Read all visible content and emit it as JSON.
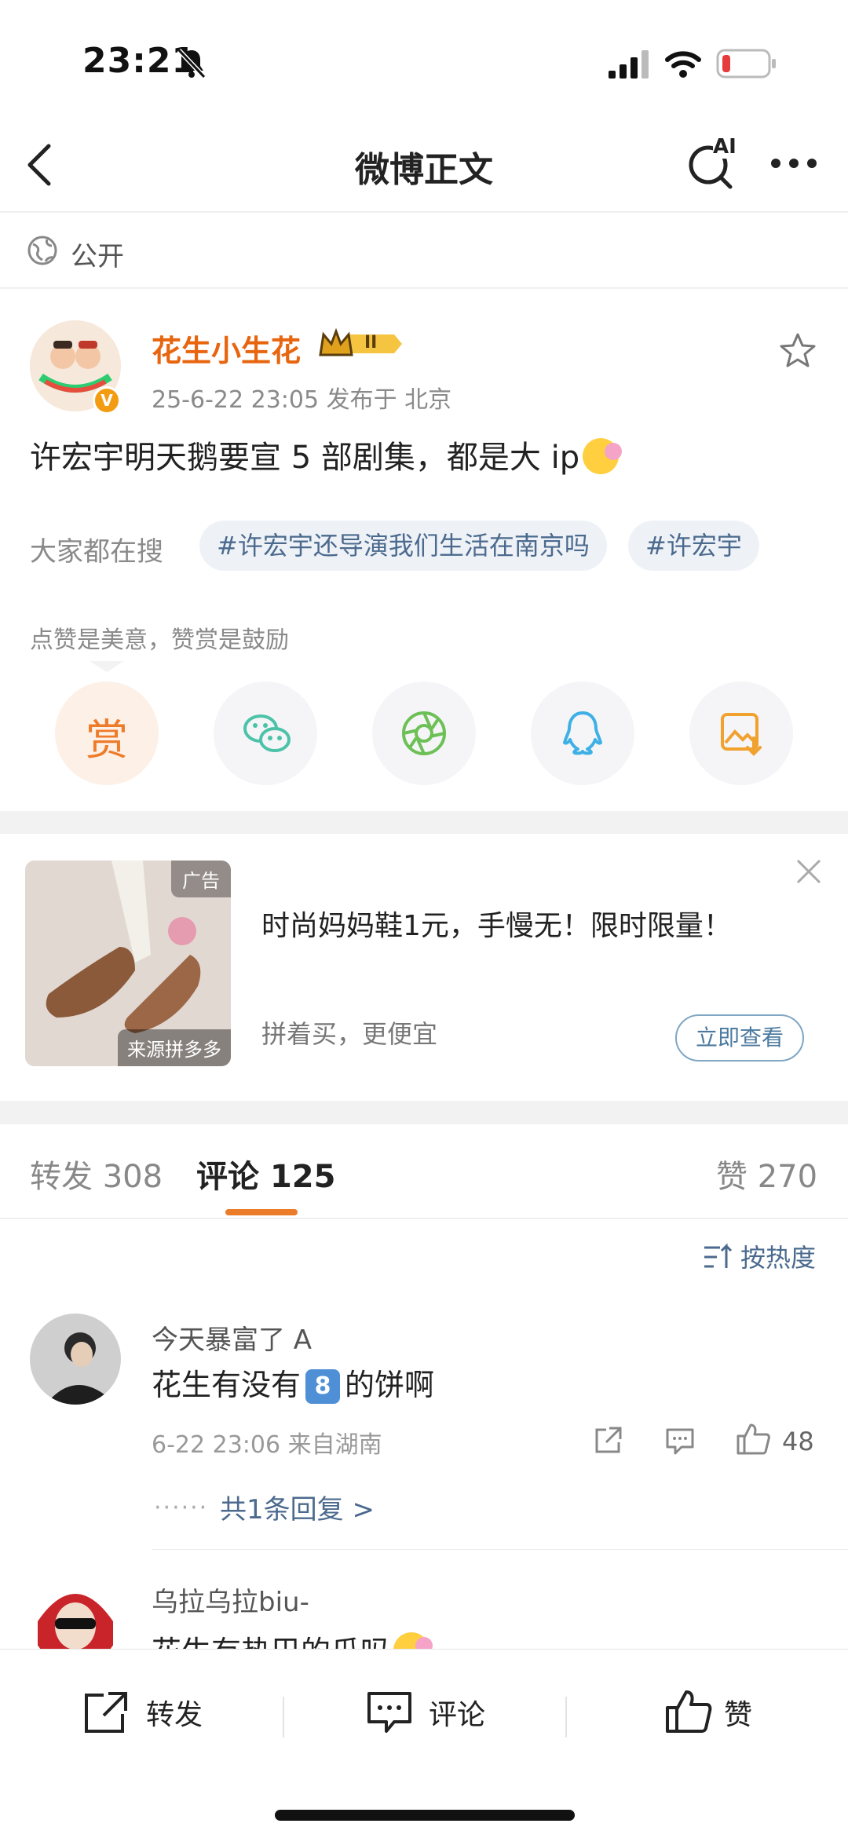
{
  "status_bar": {
    "time": "23:21"
  },
  "nav": {
    "title": "微博正文",
    "ai_label": "AI"
  },
  "visibility": {
    "label": "公开"
  },
  "post": {
    "username": "花生小生花",
    "level_badge": "II",
    "meta": "25-6-22 23:05  发布于 北京",
    "text": "许宏宇明天鹅要宣 5 部剧集，都是大 ip",
    "search_label": "大家都在搜",
    "tags": [
      "#许宏宇还导演我们生活在南京吗",
      "#许宏宇"
    ],
    "reward_hint": "点赞是美意，赞赏是鼓励",
    "reward_button": "赏"
  },
  "ad": {
    "badge": "广告",
    "source": "来源拼多多",
    "title": "时尚妈妈鞋1元，手慢无！限时限量！",
    "subtitle": "拼着买，更便宜",
    "button": "立即查看"
  },
  "tabs": [
    {
      "label": "转发",
      "count": "308"
    },
    {
      "label": "评论",
      "count": "125"
    },
    {
      "label": "赞",
      "count": "270"
    }
  ],
  "comments": {
    "sort_label": "按热度",
    "items": [
      {
        "name": "今天暴富了 A",
        "text_before": "花生有没有",
        "badge": "8",
        "text_after": "的饼啊",
        "meta": "6-22 23:06  来自湖南",
        "likes": "48",
        "replies": "共1条回复 >"
      },
      {
        "name": "乌拉乌拉biu-",
        "text": "花生有热巴的瓜吗"
      }
    ]
  },
  "bottom_bar": {
    "repost": "转发",
    "comment": "评论",
    "like": "赞"
  },
  "colors": {
    "accent": "#e8650f",
    "link": "#4b6a8e",
    "tab_indicator": "#ea7c2a"
  }
}
